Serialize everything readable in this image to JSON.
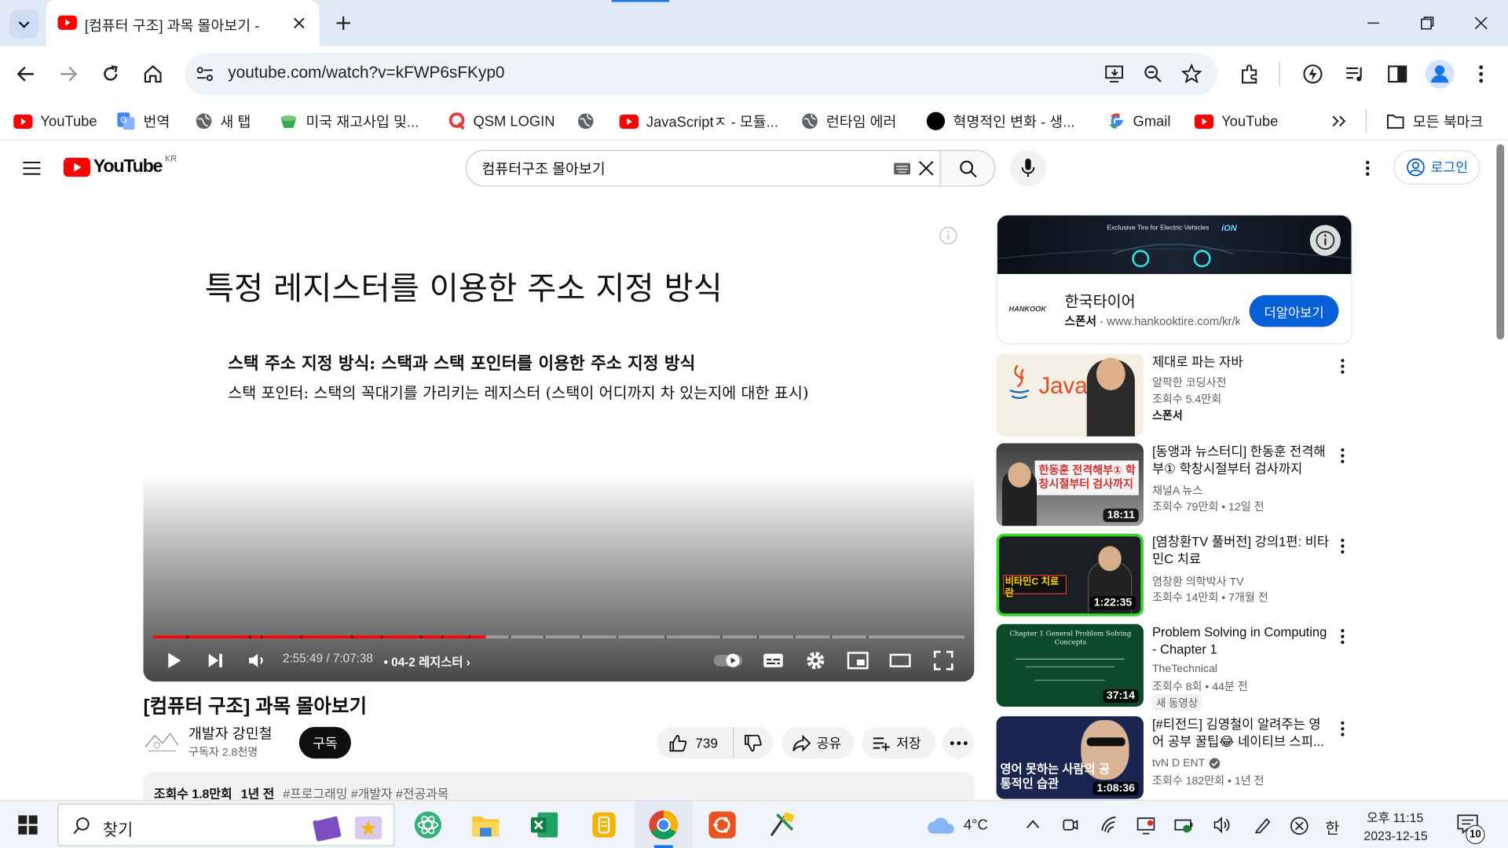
{
  "browser": {
    "tab_title": "[컴퓨터 구조] 과목 몰아보기 -",
    "url": "youtube.com/watch?v=kFWP6sFKyp0",
    "bookmarks": [
      {
        "label": "YouTube",
        "icon": "youtube-icon"
      },
      {
        "label": "번역",
        "icon": "translate-icon"
      },
      {
        "label": "새 탭",
        "icon": "globe-icon"
      },
      {
        "label": "미국 재고사입 및...",
        "icon": "cup-icon"
      },
      {
        "label": "QSM LOGIN",
        "icon": "q-icon"
      },
      {
        "label": "",
        "icon": "globe-icon"
      },
      {
        "label": "JavaScriptㅈ - 모듈...",
        "icon": "youtube-icon"
      },
      {
        "label": "런타임 에러",
        "icon": "globe-icon"
      },
      {
        "label": "혁명적인 변화 - 생...",
        "icon": "black-circle-icon"
      },
      {
        "label": "Gmail",
        "icon": "google-icon"
      },
      {
        "label": "YouTube",
        "icon": "youtube-icon"
      }
    ],
    "all_bookmarks": "모든 북마크"
  },
  "youtube": {
    "logo_text": "YouTube",
    "logo_region": "KR",
    "search_value": "컴퓨터구조 몰아보기",
    "login_label": "로그인"
  },
  "player": {
    "slide_title": "특정 레지스터를 이용한 주소 지정 방식",
    "slide_line1": "스택 주소 지정 방식: 스택과 스택 포인터를 이용한 주소 지정 방식",
    "slide_line2": "스택 포인터: 스택의 꼭대기를 가리키는 레지스터 (스택이 어디까지 차 있는지에 대한 표시)",
    "time": "2:55:49 / 7:07:38",
    "chapter": "• 04-2 레지스터",
    "progress": 0.41
  },
  "video": {
    "title": "[컴퓨터 구조] 과목 몰아보기",
    "channel": "개발자 강민철",
    "subscribers": "구독자 2.8천명",
    "subscribe_label": "구독",
    "likes": "739",
    "share_label": "공유",
    "save_label": "저장",
    "views": "조회수 1.8만회",
    "age": "1년 전",
    "tags": "#프로그래밍 #개발자 #전공과목"
  },
  "ad": {
    "banner_text": "Exclusive Tire for Electric Vehicles",
    "banner_brand": "iON",
    "logo_text": "HANKOOK",
    "name": "한국타이어",
    "sponsor_label": "스폰서",
    "domain": "www.hankooktire.com/kr/ko",
    "button": "더알아보기"
  },
  "sidebar": [
    {
      "title": "제대로 파는 자바",
      "channel": "얄팍한 코딩사전",
      "meta": "조회수 5.4만회",
      "extra": "스폰서",
      "duration": "",
      "thumb_text": "Java"
    },
    {
      "title": "[동앵과 뉴스터디] 한동훈 전격해부① 학창시절부터 검사까지",
      "channel": "채널A 뉴스",
      "meta": "조회수 79만회 • 12일 전",
      "extra": "",
      "duration": "18:11",
      "thumb_text": "한동훈 전격해부① 학창시절부터 검사까지"
    },
    {
      "title": "[염창환TV 풀버전] 강의1편: 비타민C 치료",
      "channel": "염창환 의학박사 TV",
      "meta": "조회수 14만회 • 7개월 전",
      "extra": "",
      "duration": "1:22:35",
      "thumb_text": "비타민C 치료란"
    },
    {
      "title": "Problem Solving in Computing - Chapter 1",
      "channel": "TheTechnical",
      "meta": "조회수 8회 • 44분 전",
      "extra": "새 동영상",
      "duration": "37:14",
      "thumb_text": "Chapter 1 General Problem Solving Concepts"
    },
    {
      "title": "[#티전드] 김영철이 알려주는 영어 공부 꿀팁😂 네이티브 스피...",
      "channel": "tvN D ENT",
      "meta": "조회수 182만회 • 1년 전",
      "extra": "",
      "duration": "1:08:36",
      "thumb_text": "영어 못하는 사람의 공통적인 습관"
    }
  ],
  "taskbar": {
    "search_placeholder": "찾기",
    "weather": "4°C",
    "ime": "한",
    "time": "오후 11:15",
    "date": "2023-12-15",
    "notifications": "10"
  }
}
